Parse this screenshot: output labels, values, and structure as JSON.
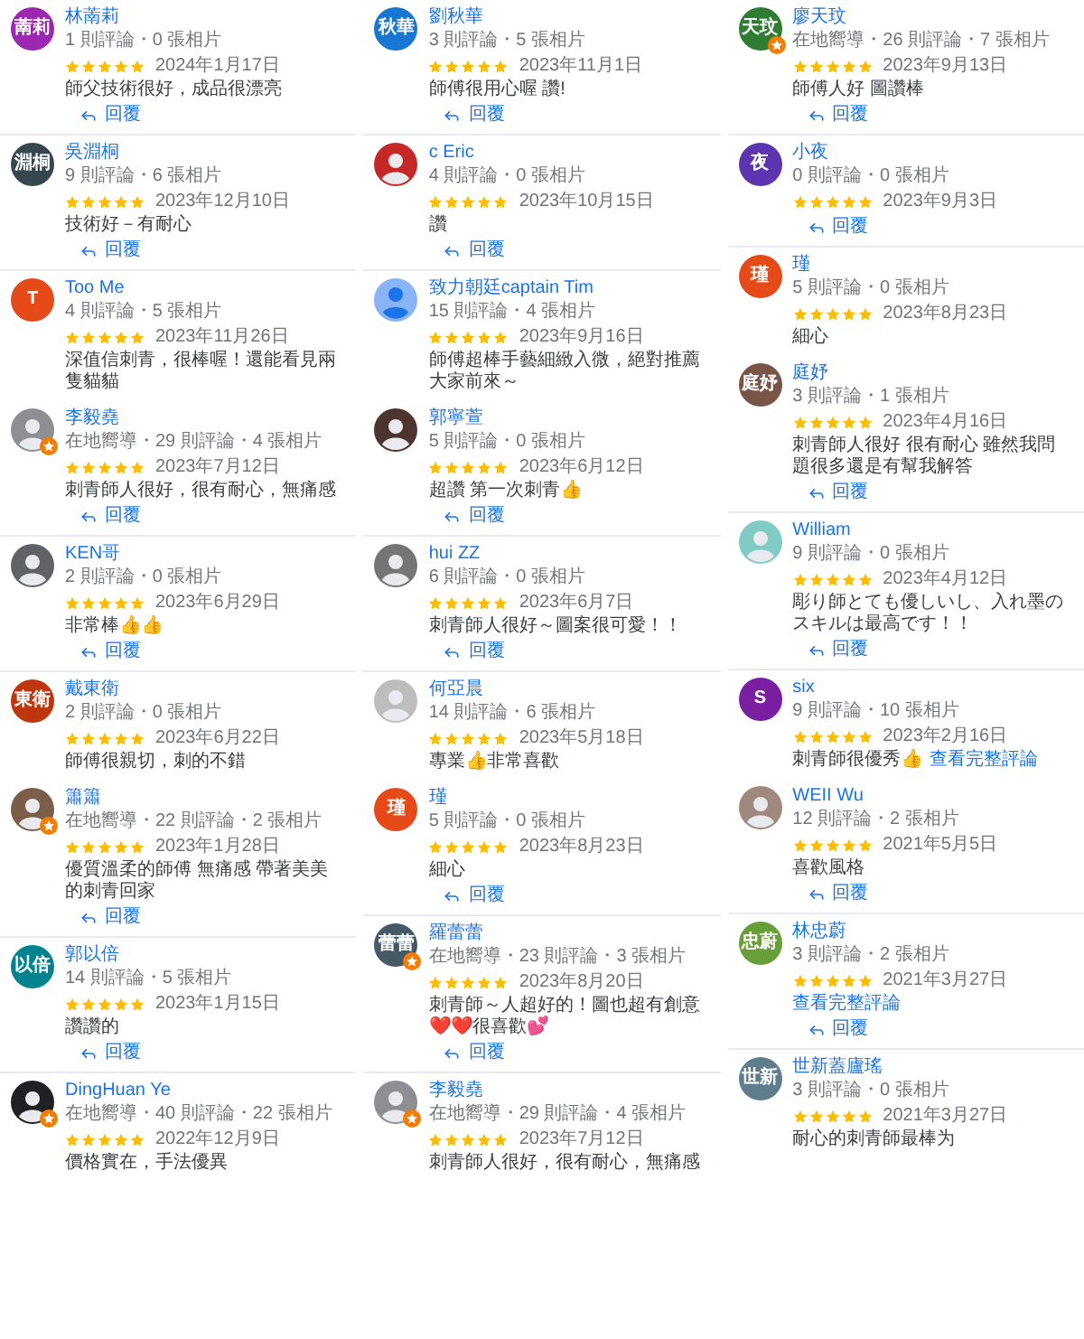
{
  "columns": [
    {
      "reviews": [
        {
          "name": "林萳莉",
          "avatar": {
            "kind": "initials",
            "text": "萳莉",
            "color": "#9c27b0"
          },
          "local_guide": false,
          "meta": "1 則評論・0 張相片",
          "stars": 5,
          "date": "2024年1月17日",
          "text": "師父技術很好，成品很漂亮",
          "reply": "回覆"
        },
        {
          "name": "吳淵桐",
          "avatar": {
            "kind": "initials",
            "text": "淵桐",
            "color": "#37474f"
          },
          "local_guide": false,
          "meta": "9 則評論・6 張相片",
          "stars": 5,
          "date": "2023年12月10日",
          "text": "技術好－有耐心",
          "reply": "回覆"
        },
        {
          "name": "Too Me",
          "avatar": {
            "kind": "initials",
            "text": "T",
            "color": "#e64a19"
          },
          "local_guide": false,
          "meta": "4 則評論・5 張相片",
          "stars": 5,
          "date": "2023年11月26日",
          "text": "深值信刺青，很棒喔！還能看見兩隻貓貓"
        },
        {
          "name": "李毅堯",
          "avatar": {
            "kind": "photo",
            "color": "#8d8f93"
          },
          "local_guide": true,
          "meta": "在地嚮導・29 則評論・4 張相片",
          "stars": 5,
          "date": "2023年7月12日",
          "text": "刺青師人很好，很有耐心，無痛感",
          "reply": "回覆"
        },
        {
          "name": "KEN哥",
          "avatar": {
            "kind": "photo",
            "color": "#5f6368"
          },
          "local_guide": false,
          "meta": "2 則評論・0 張相片",
          "stars": 5,
          "date": "2023年6月29日",
          "text": "非常棒👍👍",
          "reply": "回覆"
        },
        {
          "name": "戴東衛",
          "avatar": {
            "kind": "initials",
            "text": "東衛",
            "color": "#bf360c"
          },
          "local_guide": false,
          "meta": "2 則評論・0 張相片",
          "stars": 5,
          "date": "2023年6月22日",
          "text": "師傅很親切，刺的不錯"
        },
        {
          "name": "簫簫",
          "avatar": {
            "kind": "photo",
            "color": "#7b5e4a"
          },
          "local_guide": true,
          "meta": "在地嚮導・22 則評論・2 張相片",
          "stars": 5,
          "date": "2023年1月28日",
          "text": "優質溫柔的師傅 無痛感 帶著美美的刺青回家",
          "reply": "回覆"
        },
        {
          "name": "郭以倍",
          "avatar": {
            "kind": "initials",
            "text": "以倍",
            "color": "#00838f"
          },
          "local_guide": false,
          "meta": "14 則評論・5 張相片",
          "stars": 5,
          "date": "2023年1月15日",
          "text": "讚讚的",
          "reply": "回覆"
        },
        {
          "name": "DingHuan Ye",
          "avatar": {
            "kind": "photo",
            "color": "#202124"
          },
          "local_guide": true,
          "meta": "在地嚮導・40 則評論・22 張相片",
          "stars": 5,
          "date": "2022年12月9日",
          "text": "價格實在，手法優異"
        }
      ]
    },
    {
      "reviews": [
        {
          "name": "劉秋華",
          "avatar": {
            "kind": "initials",
            "text": "秋華",
            "color": "#1976d2"
          },
          "local_guide": false,
          "meta": "3 則評論・5 張相片",
          "stars": 5,
          "date": "2023年11月1日",
          "text": "師傅很用心喔 讚!",
          "reply": "回覆"
        },
        {
          "name": "c Eric",
          "avatar": {
            "kind": "photo",
            "color": "#c62828"
          },
          "local_guide": false,
          "meta": "4 則評論・0 張相片",
          "stars": 5,
          "date": "2023年10月15日",
          "text": "讚",
          "reply": "回覆"
        },
        {
          "name": "致力朝廷captain Tim",
          "avatar": {
            "kind": "person",
            "color": "#8ab4f8"
          },
          "local_guide": false,
          "meta": "15 則評論・4 張相片",
          "stars": 5,
          "date": "2023年9月16日",
          "text": "師傅超棒手藝細緻入微，絕對推薦大家前來～"
        },
        {
          "name": "郭寧萱",
          "avatar": {
            "kind": "photo",
            "color": "#4e342e"
          },
          "local_guide": false,
          "meta": "5 則評論・0 張相片",
          "stars": 5,
          "date": "2023年6月12日",
          "text": "超讚 第一次刺青👍",
          "reply": "回覆"
        },
        {
          "name": "hui ZZ",
          "avatar": {
            "kind": "photo",
            "color": "#757575"
          },
          "local_guide": false,
          "meta": "6 則評論・0 張相片",
          "stars": 5,
          "date": "2023年6月7日",
          "text": "刺青師人很好～圖案很可愛！！",
          "reply": "回覆"
        },
        {
          "name": "何亞晨",
          "avatar": {
            "kind": "photo",
            "color": "#bdbdbd"
          },
          "local_guide": false,
          "meta": "14 則評論・6 張相片",
          "stars": 5,
          "date": "2023年5月18日",
          "text": "專業👍非常喜歡"
        },
        {
          "name": "瑾",
          "avatar": {
            "kind": "initials",
            "text": "瑾",
            "color": "#e64a19"
          },
          "local_guide": false,
          "meta": "5 則評論・0 張相片",
          "stars": 5,
          "date": "2023年8月23日",
          "text": "細心",
          "reply": "回覆"
        },
        {
          "name": "羅蕾蕾",
          "avatar": {
            "kind": "initials",
            "text": "蕾蕾",
            "color": "#455a64"
          },
          "local_guide": true,
          "meta": "在地嚮導・23 則評論・3 張相片",
          "stars": 5,
          "date": "2023年8月20日",
          "text": "刺青師～人超好的！圖也超有創意❤️❤️很喜歡💕",
          "reply": "回覆"
        },
        {
          "name": "李毅堯",
          "avatar": {
            "kind": "photo",
            "color": "#8d8f93"
          },
          "local_guide": true,
          "meta": "在地嚮導・29 則評論・4 張相片",
          "stars": 5,
          "date": "2023年7月12日",
          "text": "刺青師人很好，很有耐心，無痛感"
        }
      ]
    },
    {
      "reviews": [
        {
          "name": "廖天玟",
          "avatar": {
            "kind": "initials",
            "text": "天玟",
            "color": "#2e7d32"
          },
          "local_guide": true,
          "meta": "在地嚮導・26 則評論・7 張相片",
          "stars": 5,
          "date": "2023年9月13日",
          "text": "師傅人好 圖讚棒",
          "reply": "回覆"
        },
        {
          "name": "小夜",
          "avatar": {
            "kind": "initials",
            "text": "夜",
            "color": "#5e35b1"
          },
          "local_guide": false,
          "meta": "0 則評論・0 張相片",
          "stars": 5,
          "date": "2023年9月3日",
          "reply": "回覆"
        },
        {
          "name": "瑾",
          "avatar": {
            "kind": "initials",
            "text": "瑾",
            "color": "#e64a19"
          },
          "local_guide": false,
          "meta": "5 則評論・0 張相片",
          "stars": 5,
          "date": "2023年8月23日",
          "text": "細心"
        },
        {
          "name": "庭妤",
          "avatar": {
            "kind": "initials",
            "text": "庭妤",
            "color": "#795548"
          },
          "local_guide": false,
          "meta": "3 則評論・1 張相片",
          "stars": 5,
          "date": "2023年4月16日",
          "text": "刺青師人很好 很有耐心 雖然我問題很多還是有幫我解答",
          "reply": "回覆"
        },
        {
          "name": "William",
          "avatar": {
            "kind": "photo",
            "color": "#80cbc4"
          },
          "local_guide": false,
          "meta": "9 則評論・0 張相片",
          "stars": 5,
          "date": "2023年4月12日",
          "text": "彫り師とても優しいし、入れ墨のスキルは最高です！！",
          "reply": "回覆"
        },
        {
          "name": "six",
          "avatar": {
            "kind": "initials",
            "text": "S",
            "color": "#7b1fa2"
          },
          "local_guide": false,
          "meta": "9 則評論・10 張相片",
          "stars": 5,
          "date": "2023年2月16日",
          "text": "刺青師很優秀👍",
          "link": "查看完整評論"
        },
        {
          "name": "WEII Wu",
          "avatar": {
            "kind": "photo",
            "color": "#a1887f"
          },
          "local_guide": false,
          "meta": "12 則評論・2 張相片",
          "stars": 5,
          "date": "2021年5月5日",
          "text": "喜歡風格",
          "reply": "回覆"
        },
        {
          "name": "林忠蔚",
          "avatar": {
            "kind": "initials",
            "text": "忠蔚",
            "color": "#689f38"
          },
          "local_guide": false,
          "meta": "3 則評論・2 張相片",
          "stars": 5,
          "date": "2021年3月27日",
          "link": "查看完整評論",
          "reply": "回覆"
        },
        {
          "name": "世新蓋廬瑤",
          "avatar": {
            "kind": "initials",
            "text": "世新",
            "color": "#607d8b"
          },
          "local_guide": false,
          "meta": "3 則評論・0 張相片",
          "stars": 5,
          "date": "2021年3月27日",
          "text": "耐心的刺青師最棒为"
        }
      ]
    }
  ]
}
